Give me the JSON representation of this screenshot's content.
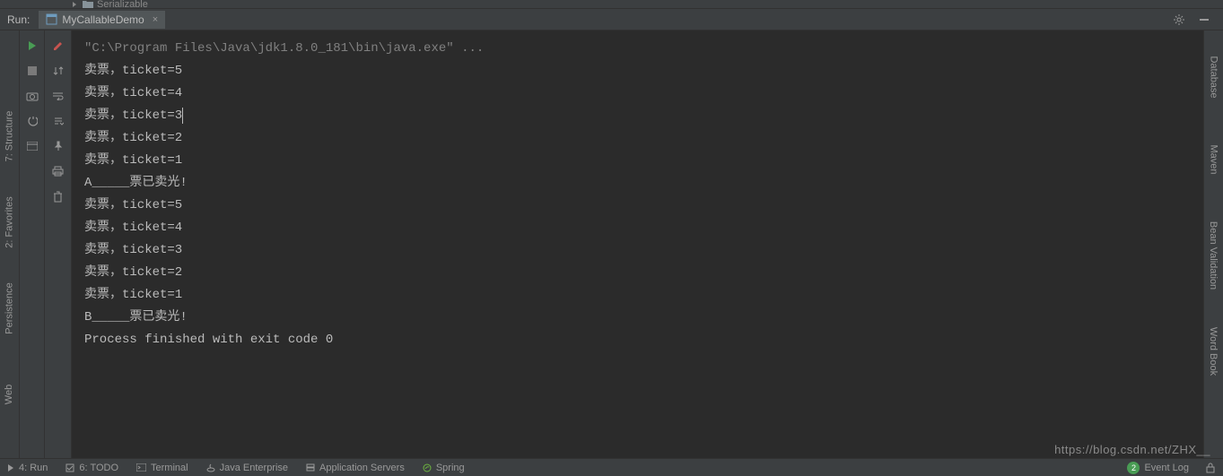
{
  "breadcrumb": {
    "folder_name": "Serializable"
  },
  "run_panel": {
    "label": "Run:",
    "tab_title": "MyCallableDemo"
  },
  "console": {
    "command": "\"C:\\Program Files\\Java\\jdk1.8.0_181\\bin\\java.exe\" ...",
    "lines": [
      "卖票，ticket=5",
      "卖票，ticket=4",
      "卖票，ticket=3",
      "卖票，ticket=2",
      "卖票，ticket=1",
      "A_____票已卖光!",
      "卖票，ticket=5",
      "卖票，ticket=4",
      "卖票，ticket=3",
      "卖票，ticket=2",
      "卖票，ticket=1",
      "B_____票已卖光!",
      "",
      "Process finished with exit code 0"
    ]
  },
  "left_tools": {
    "structure": "7: Structure",
    "favorites": "2: Favorites",
    "persistence": "Persistence",
    "web": "Web"
  },
  "right_tools": {
    "database": "Database",
    "maven": "Maven",
    "bean_validation": "Bean Validation",
    "word_book": "Word Book"
  },
  "status": {
    "run": "4: Run",
    "todo": "6: TODO",
    "terminal": "Terminal",
    "java_enterprise": "Java Enterprise",
    "app_servers": "Application Servers",
    "spring": "Spring",
    "event_log": "Event Log",
    "event_count": "2"
  },
  "watermark": "https://blog.csdn.net/ZHX__"
}
